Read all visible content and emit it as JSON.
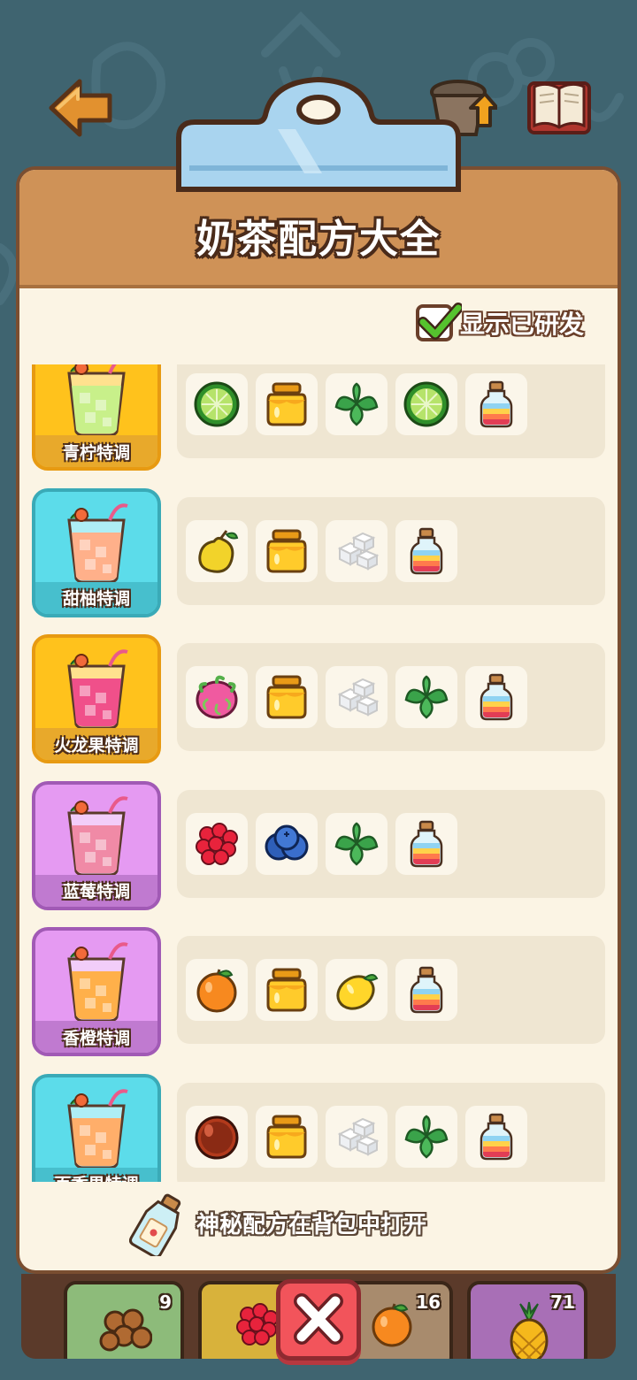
{
  "title": "奶茶配方大全",
  "toggle": {
    "label": "显示已研发",
    "checked": true
  },
  "recipes": [
    {
      "name": "青柠特调",
      "card": "yellow",
      "ingredients": [
        "lime-icon",
        "honey-jar-icon",
        "mint-icon",
        "lime-icon",
        "rainbow-bottle-icon"
      ]
    },
    {
      "name": "甜柚特调",
      "card": "cyan",
      "ingredients": [
        "pear-icon",
        "honey-jar-icon",
        "sugar-cubes-icon",
        "rainbow-bottle-icon"
      ]
    },
    {
      "name": "火龙果特调",
      "card": "yellow",
      "ingredients": [
        "dragon-fruit-icon",
        "honey-jar-icon",
        "sugar-cubes-icon",
        "mint-icon",
        "rainbow-bottle-icon"
      ]
    },
    {
      "name": "蓝莓特调",
      "card": "purple",
      "ingredients": [
        "raspberry-icon",
        "blueberry-icon",
        "mint-icon",
        "rainbow-bottle-icon"
      ]
    },
    {
      "name": "香橙特调",
      "card": "purple",
      "ingredients": [
        "orange-icon",
        "honey-jar-icon",
        "lemon-icon",
        "rainbow-bottle-icon"
      ]
    },
    {
      "name": "百香果特调",
      "card": "cyan",
      "ingredients": [
        "passion-fruit-icon",
        "honey-jar-icon",
        "sugar-cubes-icon",
        "mint-icon",
        "rainbow-bottle-icon"
      ]
    }
  ],
  "footer": {
    "text": "神秘配方在背包中打开"
  },
  "tray": [
    {
      "icon": "longan-icon",
      "count": "9",
      "color": "#8dbb7a"
    },
    {
      "icon": "raspberry-icon",
      "count": "",
      "color": "#d8b23b"
    },
    {
      "icon": "orange-icon",
      "count": "16",
      "color": "#a88b6d"
    },
    {
      "icon": "pineapple-icon",
      "count": "71",
      "color": "#a86fb6"
    }
  ],
  "colors": {
    "header": "#cf9257",
    "paper": "#fbf4e4",
    "board": "#7a4e31",
    "close": "#f2545b"
  }
}
